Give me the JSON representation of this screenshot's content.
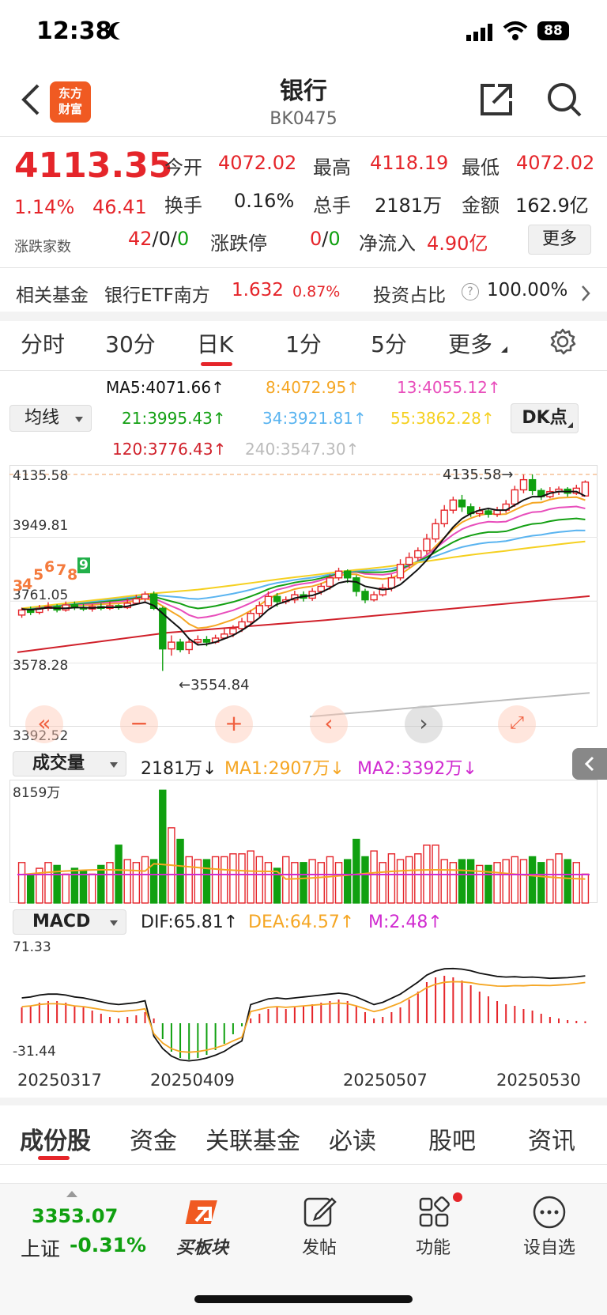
{
  "status": {
    "time": "12:38",
    "battery": "88"
  },
  "nav": {
    "title": "银行",
    "code": "BK0475",
    "logo": "东方财富"
  },
  "quote": {
    "price": "4113.35",
    "change_pct": "1.14%",
    "change": "46.41",
    "open_label": "今开",
    "open": "4072.02",
    "high_label": "最高",
    "high": "4118.19",
    "low_label": "最低",
    "low": "4072.02",
    "turnover_label": "换手",
    "turnover": "0.16%",
    "volume_label": "总手",
    "volume": "2181万",
    "amount_label": "金额",
    "amount": "162.9亿",
    "breadth_label": "涨跌家数",
    "breadth_up": "42",
    "breadth_sep1": "/",
    "breadth_flat": "0",
    "breadth_sep2": "/",
    "breadth_down": "0",
    "limit_label": "涨跌停",
    "limit_up": "0",
    "limit_sep": "/",
    "limit_down": "0",
    "inflow_label": "净流入",
    "inflow": "4.90亿",
    "more_button": "更多"
  },
  "fund": {
    "label": "相关基金",
    "name": "银行ETF南方",
    "price": "1.632",
    "pct": "0.87%",
    "ratio_label": "投资占比",
    "ratio": "100.00%"
  },
  "tabs": [
    "分时",
    "30分",
    "日K",
    "1分",
    "5分",
    "更多"
  ],
  "active_tab": 2,
  "ma": {
    "selector": "均线",
    "dk_button": "DK点",
    "ma5": "MA5:4071.66↑",
    "ma8": "8:4072.95↑",
    "ma13": "13:4055.12↑",
    "ma21": "21:3995.43↑",
    "ma34": "34:3921.81↑",
    "ma55": "55:3862.28↑",
    "ma120": "120:3776.43↑",
    "ma240": "240:3547.30↑",
    "colors": {
      "ma5": "#111111",
      "ma8": "#f5a623",
      "ma13": "#e84dbb",
      "ma21": "#14a014",
      "ma34": "#5ab4f0",
      "ma55": "#f5d020",
      "ma120": "#d0202a",
      "ma240": "#bbbbbb"
    }
  },
  "kline": {
    "axis": {
      "top": "4135.58",
      "mid1": "3949.81",
      "mid2": "3761.05",
      "mid3": "3578.28",
      "bottom": "3392.52"
    },
    "high_marker": "4135.58→",
    "low_marker": "←3554.84",
    "td_numbers": [
      "3",
      "4",
      "5",
      "6",
      "7",
      "8",
      "9"
    ]
  },
  "volume": {
    "selector": "成交量",
    "current": "2181万↓",
    "ma1": "MA1:2907万↓",
    "ma2": "MA2:3392万↓",
    "axis_top": "8159万"
  },
  "macd": {
    "selector": "MACD",
    "dif": "DIF:65.81↑",
    "dea": "DEA:64.57↑",
    "m": "M:2.48↑",
    "axis_top": "71.33",
    "axis_bottom": "-31.44"
  },
  "dates": [
    "20250317",
    "20250409",
    "20250507",
    "20250530"
  ],
  "bottom_tabs": [
    "成份股",
    "资金",
    "关联基金",
    "必读",
    "股吧",
    "资讯"
  ],
  "dock": {
    "index_value": "3353.07",
    "index_name": "上证",
    "index_pct": "-0.31%",
    "buy_label": "买板块",
    "post_label": "发帖",
    "func_label": "功能",
    "watch_label": "设自选"
  },
  "chart_data": {
    "type": "candlestick",
    "candles": [
      [
        3720,
        3735,
        3712,
        3742
      ],
      [
        3735,
        3728,
        3720,
        3745
      ],
      [
        3728,
        3740,
        3722,
        3750
      ],
      [
        3740,
        3745,
        3732,
        3758
      ],
      [
        3745,
        3735,
        3728,
        3752
      ],
      [
        3735,
        3750,
        3730,
        3760
      ],
      [
        3750,
        3742,
        3735,
        3760
      ],
      [
        3742,
        3738,
        3732,
        3752
      ],
      [
        3738,
        3745,
        3730,
        3752
      ],
      [
        3745,
        3740,
        3734,
        3755
      ],
      [
        3740,
        3748,
        3735,
        3760
      ],
      [
        3748,
        3742,
        3736,
        3752
      ],
      [
        3742,
        3755,
        3738,
        3770
      ],
      [
        3755,
        3768,
        3750,
        3780
      ],
      [
        3768,
        3782,
        3760,
        3790
      ],
      [
        3782,
        3740,
        3735,
        3790
      ],
      [
        3740,
        3620,
        3555,
        3745
      ],
      [
        3620,
        3640,
        3600,
        3660
      ],
      [
        3640,
        3618,
        3610,
        3650
      ],
      [
        3618,
        3640,
        3605,
        3648
      ],
      [
        3640,
        3648,
        3630,
        3660
      ],
      [
        3648,
        3640,
        3628,
        3658
      ],
      [
        3640,
        3652,
        3635,
        3662
      ],
      [
        3652,
        3664,
        3648,
        3680
      ],
      [
        3664,
        3680,
        3655,
        3690
      ],
      [
        3680,
        3700,
        3670,
        3712
      ],
      [
        3700,
        3725,
        3690,
        3735
      ],
      [
        3725,
        3748,
        3715,
        3760
      ],
      [
        3748,
        3775,
        3740,
        3790
      ],
      [
        3775,
        3760,
        3745,
        3785
      ],
      [
        3760,
        3765,
        3752,
        3775
      ],
      [
        3765,
        3780,
        3755,
        3792
      ],
      [
        3780,
        3770,
        3760,
        3790
      ],
      [
        3770,
        3790,
        3762,
        3800
      ],
      [
        3790,
        3805,
        3780,
        3815
      ],
      [
        3805,
        3830,
        3795,
        3840
      ],
      [
        3830,
        3850,
        3822,
        3860
      ],
      [
        3850,
        3830,
        3815,
        3855
      ],
      [
        3830,
        3790,
        3775,
        3838
      ],
      [
        3790,
        3765,
        3755,
        3798
      ],
      [
        3765,
        3780,
        3760,
        3790
      ],
      [
        3780,
        3800,
        3775,
        3812
      ],
      [
        3800,
        3830,
        3790,
        3840
      ],
      [
        3830,
        3870,
        3822,
        3885
      ],
      [
        3870,
        3890,
        3860,
        3905
      ],
      [
        3890,
        3910,
        3880,
        3920
      ],
      [
        3910,
        3945,
        3900,
        3960
      ],
      [
        3945,
        3990,
        3935,
        4005
      ],
      [
        3990,
        4030,
        3980,
        4045
      ],
      [
        4030,
        4060,
        4020,
        4070
      ],
      [
        4060,
        4040,
        4025,
        4075
      ],
      [
        4040,
        4020,
        4010,
        4050
      ],
      [
        4020,
        4028,
        4010,
        4040
      ],
      [
        4028,
        4018,
        4008,
        4035
      ],
      [
        4018,
        4030,
        4010,
        4040
      ],
      [
        4030,
        4048,
        4022,
        4060
      ],
      [
        4048,
        4090,
        4040,
        4102
      ],
      [
        4090,
        4120,
        4080,
        4135
      ],
      [
        4120,
        4088,
        4075,
        4135.58
      ],
      [
        4088,
        4070,
        4060,
        4095
      ],
      [
        4070,
        4085,
        4065,
        4098
      ],
      [
        4085,
        4092,
        4075,
        4100
      ],
      [
        4092,
        4080,
        4070,
        4098
      ],
      [
        4080,
        4095,
        4075,
        4105
      ],
      [
        4072,
        4113,
        4072,
        4118
      ]
    ],
    "candle_order": "open,close,low,high",
    "ma_series": {
      "ma5": [
        3738,
        3736,
        3738,
        3742,
        3740,
        3740,
        3742,
        3742,
        3741,
        3743,
        3743,
        3743,
        3746,
        3752,
        3758,
        3748,
        3725,
        3702,
        3680,
        3650,
        3632,
        3634,
        3640,
        3650,
        3660,
        3675,
        3692,
        3712,
        3736,
        3752,
        3760,
        3770,
        3775,
        3778,
        3787,
        3800,
        3815,
        3820,
        3818,
        3805,
        3800,
        3795,
        3798,
        3810,
        3832,
        3855,
        3882,
        3915,
        3948,
        3980,
        4005,
        4020,
        4030,
        4035,
        4030,
        4030,
        4045,
        4060,
        4070,
        4070,
        4080,
        4085,
        4085,
        4085,
        4071.66
      ]
    },
    "volume_bars": [
      28,
      20,
      24,
      28,
      26,
      20,
      24,
      22,
      20,
      26,
      28,
      40,
      30,
      28,
      32,
      30,
      78,
      52,
      44,
      32,
      30,
      30,
      32,
      32,
      34,
      34,
      36,
      32,
      28,
      24,
      32,
      28,
      28,
      30,
      28,
      32,
      28,
      30,
      44,
      32,
      36,
      28,
      34,
      30,
      32,
      34,
      40,
      40,
      30,
      28,
      30,
      30,
      26,
      26,
      28,
      30,
      32,
      30,
      32,
      28,
      30,
      34,
      30,
      28,
      20
    ],
    "volume_colors": "up=red hollow, down=green filled",
    "macd_hist": [
      20,
      22,
      26,
      28,
      28,
      26,
      22,
      20,
      16,
      12,
      8,
      6,
      8,
      10,
      14,
      6,
      -20,
      -36,
      -44,
      -46,
      -44,
      -40,
      -34,
      -26,
      -14,
      -4,
      6,
      12,
      18,
      20,
      18,
      20,
      22,
      24,
      26,
      28,
      30,
      28,
      22,
      14,
      6,
      8,
      14,
      20,
      30,
      40,
      52,
      58,
      60,
      58,
      54,
      48,
      40,
      34,
      28,
      24,
      22,
      18,
      16,
      12,
      8,
      6,
      4,
      3,
      2.48
    ],
    "title": "",
    "ylim": [
      3392.52,
      4135.58
    ]
  }
}
